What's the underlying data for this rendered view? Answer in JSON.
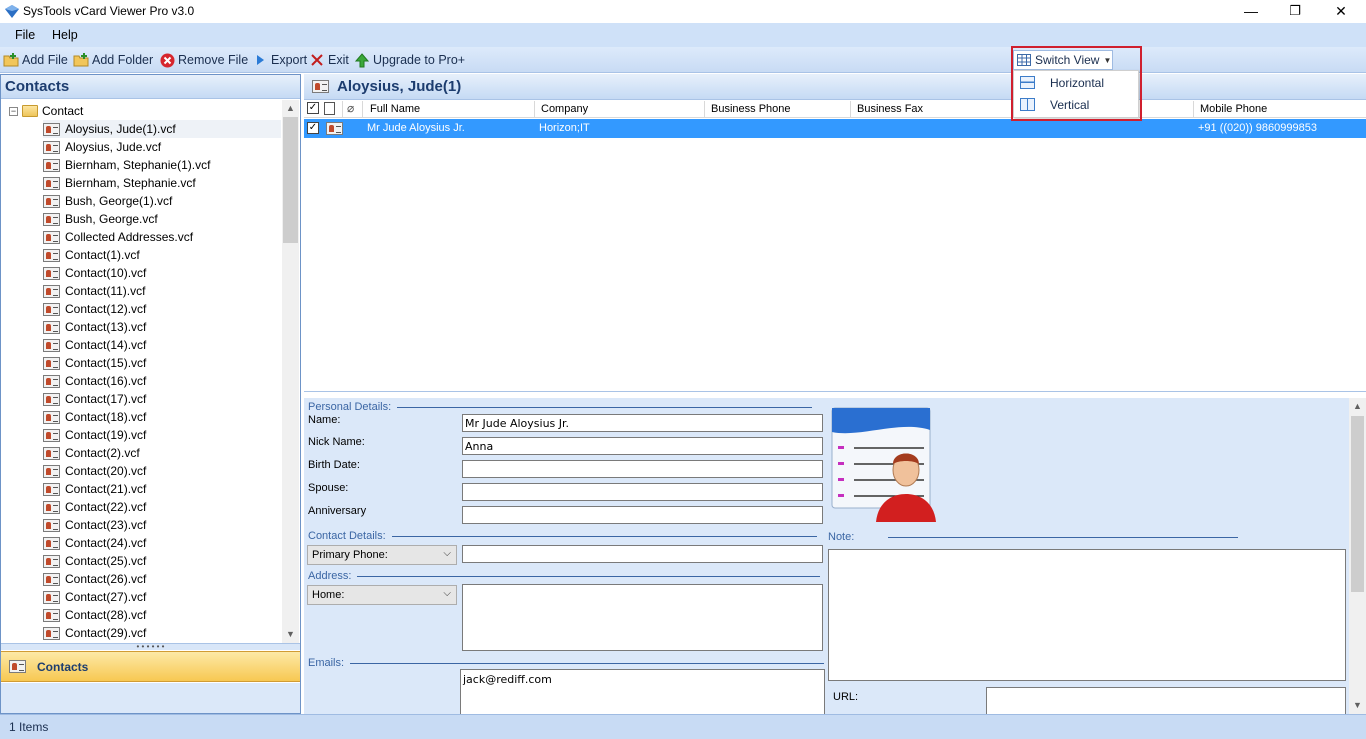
{
  "window": {
    "title": "SysTools vCard Viewer Pro v3.0",
    "minimize_glyph": "—",
    "restore_glyph": "❐",
    "close_glyph": "✕"
  },
  "menu": {
    "file": "File",
    "help": "Help"
  },
  "toolbar": {
    "add_file": "Add File",
    "add_folder": "Add Folder",
    "remove_file": "Remove File",
    "export": "Export",
    "exit": "Exit",
    "upgrade": "Upgrade to Pro+"
  },
  "switch_view": {
    "label": "Switch View",
    "options": [
      "Horizontal",
      "Vertical"
    ]
  },
  "left_panel": {
    "title": "Contacts",
    "root": "Contact",
    "items": [
      "Aloysius, Jude(1).vcf",
      "Aloysius, Jude.vcf",
      "Biernham, Stephanie(1).vcf",
      "Biernham, Stephanie.vcf",
      "Bush, George(1).vcf",
      "Bush, George.vcf",
      "Collected Addresses.vcf",
      "Contact(1).vcf",
      "Contact(10).vcf",
      "Contact(11).vcf",
      "Contact(12).vcf",
      "Contact(13).vcf",
      "Contact(14).vcf",
      "Contact(15).vcf",
      "Contact(16).vcf",
      "Contact(17).vcf",
      "Contact(18).vcf",
      "Contact(19).vcf",
      "Contact(2).vcf",
      "Contact(20).vcf",
      "Contact(21).vcf",
      "Contact(22).vcf",
      "Contact(23).vcf",
      "Contact(24).vcf",
      "Contact(25).vcf",
      "Contact(26).vcf",
      "Contact(27).vcf",
      "Contact(28).vcf",
      "Contact(29).vcf"
    ],
    "selected_index": 0,
    "nav_label": "Contacts"
  },
  "contact_header": "Aloysius, Jude(1)",
  "grid": {
    "columns": [
      "Full Name",
      "Company",
      "Business Phone",
      "Business Fax",
      "Mobile Phone"
    ],
    "row": {
      "full_name": "Mr Jude Aloysius Jr.",
      "company": "Horizon;IT",
      "business_phone": "",
      "business_fax": "",
      "mobile_phone": "+91 ((020)) 9860999853"
    }
  },
  "details": {
    "personal_section": "Personal Details:",
    "name_label": "Name:",
    "name_value": "Mr Jude Aloysius Jr.",
    "nick_label": "Nick Name:",
    "nick_value": "Anna",
    "birth_label": "Birth Date:",
    "birth_value": "",
    "spouse_label": "Spouse:",
    "spouse_value": "",
    "anniversary_label": "Anniversary",
    "anniversary_value": "",
    "contact_section": "Contact Details:",
    "phone_select": "Primary Phone:",
    "phone_value": "",
    "address_section": "Address:",
    "address_select": "Home:",
    "address_value": "",
    "emails_section": "Emails:",
    "email_value": "jack@rediff.com",
    "note_section": "Note:",
    "note_value": "",
    "url_label": "URL:",
    "url_value": ""
  },
  "status": "1 Items"
}
